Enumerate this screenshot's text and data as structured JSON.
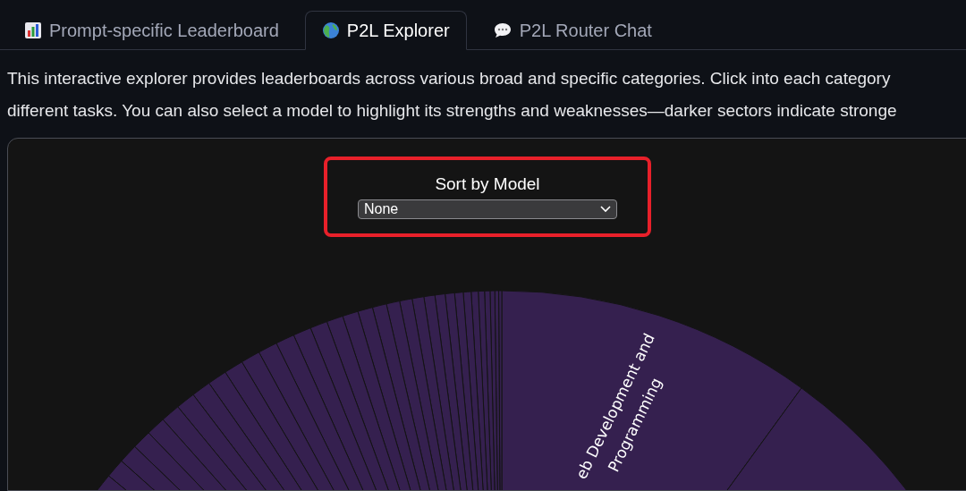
{
  "tabs": [
    {
      "label": "Prompt-specific Leaderboard",
      "selected": false
    },
    {
      "label": "P2L Explorer",
      "selected": true
    },
    {
      "label": "P2L Router Chat",
      "selected": false
    }
  ],
  "description": [
    "This interactive explorer provides leaderboards across various broad and specific categories. Click into each category",
    "different tasks. You can also select a model to highlight its strengths and weaknesses—darker sectors indicate stronge"
  ],
  "explorer": {
    "highlighted": true,
    "sort_control": {
      "label": "Sort by Model",
      "value": "None"
    },
    "sunburst": {
      "labels": [
        "eb Development and",
        "Programming"
      ]
    }
  }
}
